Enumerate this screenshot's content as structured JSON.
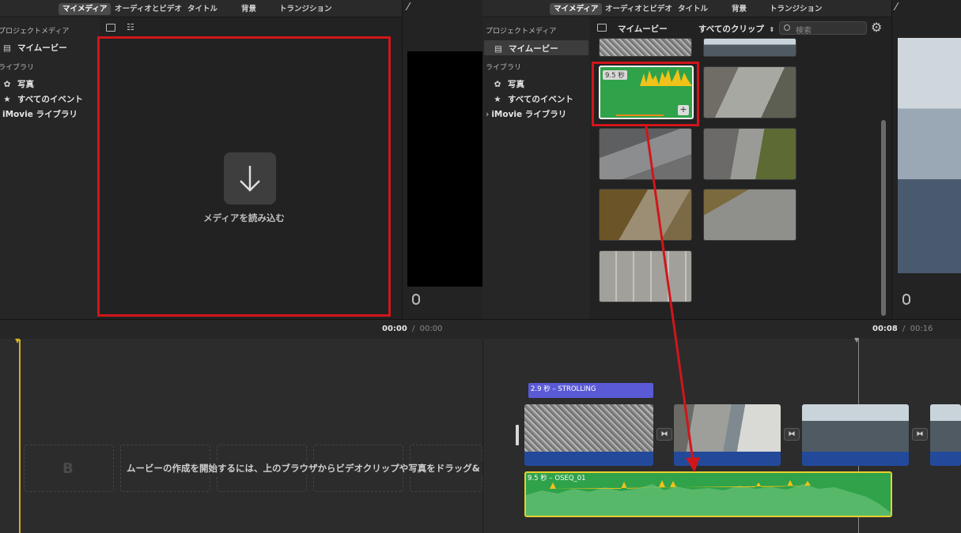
{
  "left": {
    "tabs": [
      "マイメディア",
      "オーディオとビデオ",
      "タイトル",
      "背景",
      "トランジション"
    ],
    "sidebar": {
      "section_project": "プロジェクトメディア",
      "my_movie": "マイムービー",
      "section_library": "ライブラリ",
      "photos": "写真",
      "all_events": "すべてのイベント",
      "imovie_library": "iMovie ライブラリ"
    },
    "import_label": "メディアを読み込む"
  },
  "right": {
    "tabs": [
      "マイメディア",
      "オーディオとビデオ",
      "タイトル",
      "背景",
      "トランジション"
    ],
    "sidebar": {
      "section_project": "プロジェクトメディア",
      "my_movie": "マイムービー",
      "section_library": "ライブラリ",
      "photos": "写真",
      "all_events": "すべてのイベント",
      "imovie_library": "iMovie ライブラリ"
    },
    "browser_title": "マイムービー",
    "filter": "すべてのクリップ",
    "search_placeholder": "検索",
    "selected_clip_duration": "9.5 秒"
  },
  "timeline": {
    "left_time_current": "00:00",
    "left_time_total": "00:00",
    "right_time_current": "00:08",
    "right_time_total": "00:16",
    "separator": "/",
    "empty_message": "ムービーの作成を開始するには、上のブラウザからビデオクリップや写真をドラッグ&ド",
    "placeholder_glyph": "B",
    "title_clip_label": "2.9 秒 – STROLLING",
    "audio_clip_label": "9.5 秒 –  OSEQ_01"
  },
  "colors": {
    "highlight": "#d0161b",
    "audio_clip": "#2fa24a",
    "audio_wave": "#f0c21a",
    "title_clip": "#5a5ad6",
    "video_bar": "#234a9a"
  },
  "icons": [
    "magic-wand-icon",
    "sidebar-toggle-icon",
    "clapboard-icon",
    "flower-icon",
    "star-icon",
    "chevron-right-icon",
    "import-arrow-icon",
    "search-icon",
    "gear-icon",
    "microphone-icon",
    "transition-icon",
    "plus-icon"
  ]
}
